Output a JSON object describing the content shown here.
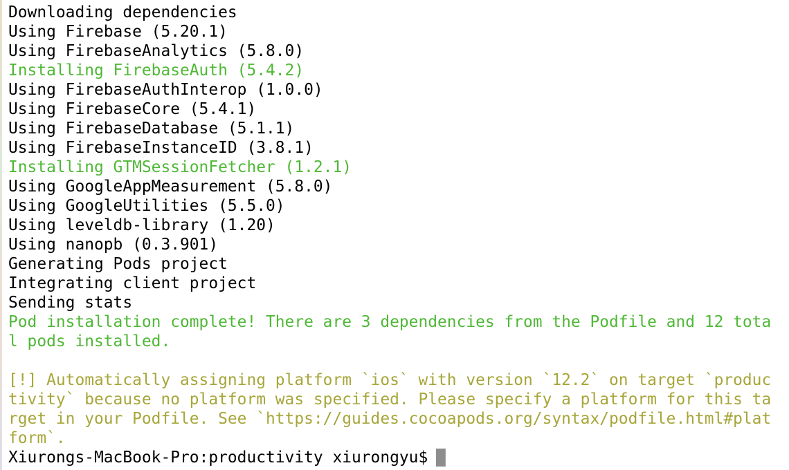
{
  "colors": {
    "background": "#ffffff",
    "text": "#000000",
    "success": "#4fb836",
    "warning": "#a7a63a",
    "cursor": "#8d8d8d"
  },
  "terminal": {
    "lines": [
      {
        "text": "Downloading dependencies",
        "style": "normal"
      },
      {
        "text": "Using Firebase (5.20.1)",
        "style": "normal"
      },
      {
        "text": "Using FirebaseAnalytics (5.8.0)",
        "style": "normal"
      },
      {
        "text": "Installing FirebaseAuth (5.4.2)",
        "style": "green"
      },
      {
        "text": "Using FirebaseAuthInterop (1.0.0)",
        "style": "normal"
      },
      {
        "text": "Using FirebaseCore (5.4.1)",
        "style": "normal"
      },
      {
        "text": "Using FirebaseDatabase (5.1.1)",
        "style": "normal"
      },
      {
        "text": "Using FirebaseInstanceID (3.8.1)",
        "style": "normal"
      },
      {
        "text": "Installing GTMSessionFetcher (1.2.1)",
        "style": "green"
      },
      {
        "text": "Using GoogleAppMeasurement (5.8.0)",
        "style": "normal"
      },
      {
        "text": "Using GoogleUtilities (5.5.0)",
        "style": "normal"
      },
      {
        "text": "Using leveldb-library (1.20)",
        "style": "normal"
      },
      {
        "text": "Using nanopb (0.3.901)",
        "style": "normal"
      },
      {
        "text": "Generating Pods project",
        "style": "normal"
      },
      {
        "text": "Integrating client project",
        "style": "normal"
      },
      {
        "text": "Sending stats",
        "style": "normal"
      },
      {
        "text": "Pod installation complete! There are 3 dependencies from the Podfile and 12 tota",
        "style": "green"
      },
      {
        "text": "l pods installed.",
        "style": "green"
      },
      {
        "text": "",
        "style": "blank"
      },
      {
        "text": "[!] Automatically assigning platform `ios` with version `12.2` on target `produc",
        "style": "olive"
      },
      {
        "text": "tivity` because no platform was specified. Please specify a platform for this ta",
        "style": "olive"
      },
      {
        "text": "rget in your Podfile. See `https://guides.cocoapods.org/syntax/podfile.html#plat",
        "style": "olive"
      },
      {
        "text": "form`.",
        "style": "olive"
      }
    ],
    "prompt": "Xiurongs-MacBook-Pro:productivity xiurongyu$"
  }
}
